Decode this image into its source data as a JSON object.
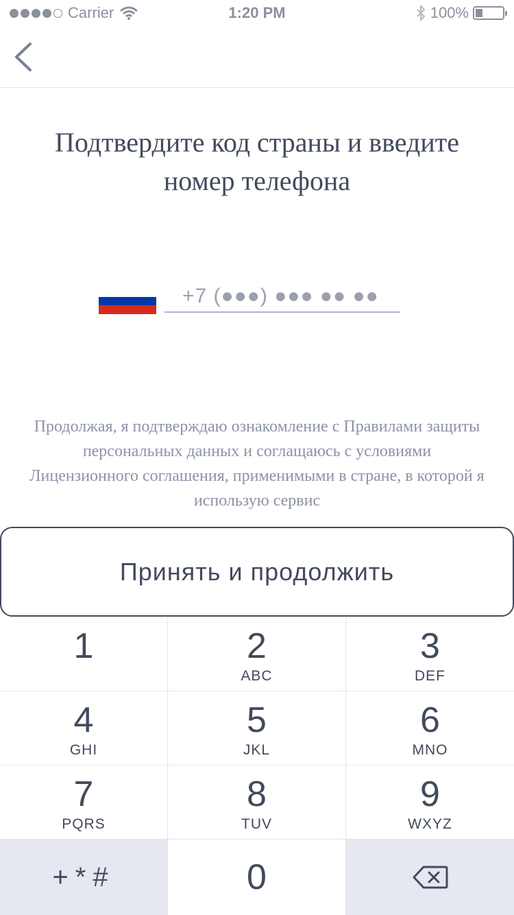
{
  "status_bar": {
    "carrier": "Carrier",
    "time": "1:20 PM",
    "battery": "100%",
    "battery_level": 0.25
  },
  "nav": {
    "back_icon": "chevron-left-icon"
  },
  "title": "Подтвердите код страны и введите номер телефона",
  "country": {
    "flag_colors": [
      "#ffffff",
      "#0039a6",
      "#d52b1e"
    ]
  },
  "phone": {
    "placeholder": "+7 (●●●) ●●● ●● ●●",
    "value": ""
  },
  "consent_text": "Продолжая, я подтверждаю ознакомление с Правилами защиты персональных данных и соглащаюсь с условиями Лицензионного соглашения, применимыми в стране, в которой я использую сервис",
  "accept_button": "Принять и продолжить",
  "keypad": {
    "keys": [
      {
        "digit": "1",
        "letters": ""
      },
      {
        "digit": "2",
        "letters": "ABC"
      },
      {
        "digit": "3",
        "letters": "DEF"
      },
      {
        "digit": "4",
        "letters": "GHI"
      },
      {
        "digit": "5",
        "letters": "JKL"
      },
      {
        "digit": "6",
        "letters": "MNO"
      },
      {
        "digit": "7",
        "letters": "PQRS"
      },
      {
        "digit": "8",
        "letters": "TUV"
      },
      {
        "digit": "9",
        "letters": "WXYZ"
      }
    ],
    "symbols": "+*#",
    "zero": "0",
    "delete_icon": "backspace-icon"
  },
  "colors": {
    "text": "#424a5c",
    "muted": "#8c93a8",
    "input_underline": "#b9a9e6",
    "key_func_bg": "#e5e8f0"
  }
}
